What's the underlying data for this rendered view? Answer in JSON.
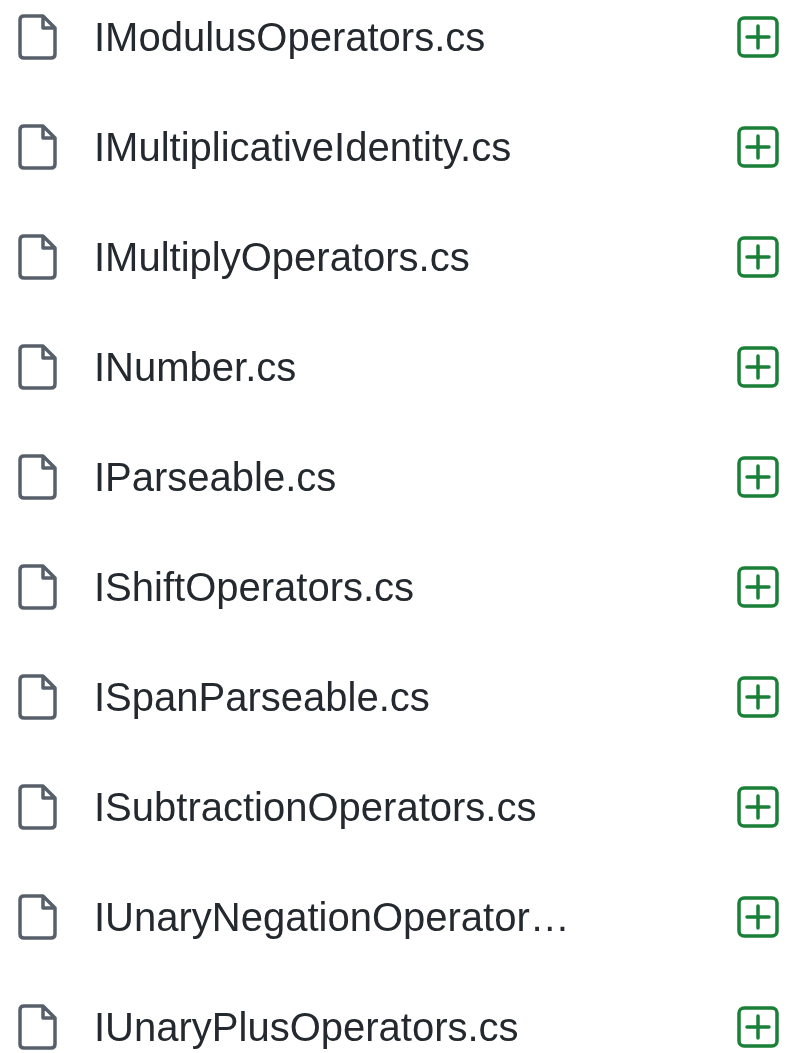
{
  "files": [
    {
      "name": "IModulusOperators.cs"
    },
    {
      "name": "IMultiplicativeIdentity.cs"
    },
    {
      "name": "IMultiplyOperators.cs"
    },
    {
      "name": "INumber.cs"
    },
    {
      "name": "IParseable.cs"
    },
    {
      "name": "IShiftOperators.cs"
    },
    {
      "name": "ISpanParseable.cs"
    },
    {
      "name": "ISubtractionOperators.cs"
    },
    {
      "name": "IUnaryNegationOperator…"
    },
    {
      "name": "IUnaryPlusOperators.cs"
    }
  ]
}
